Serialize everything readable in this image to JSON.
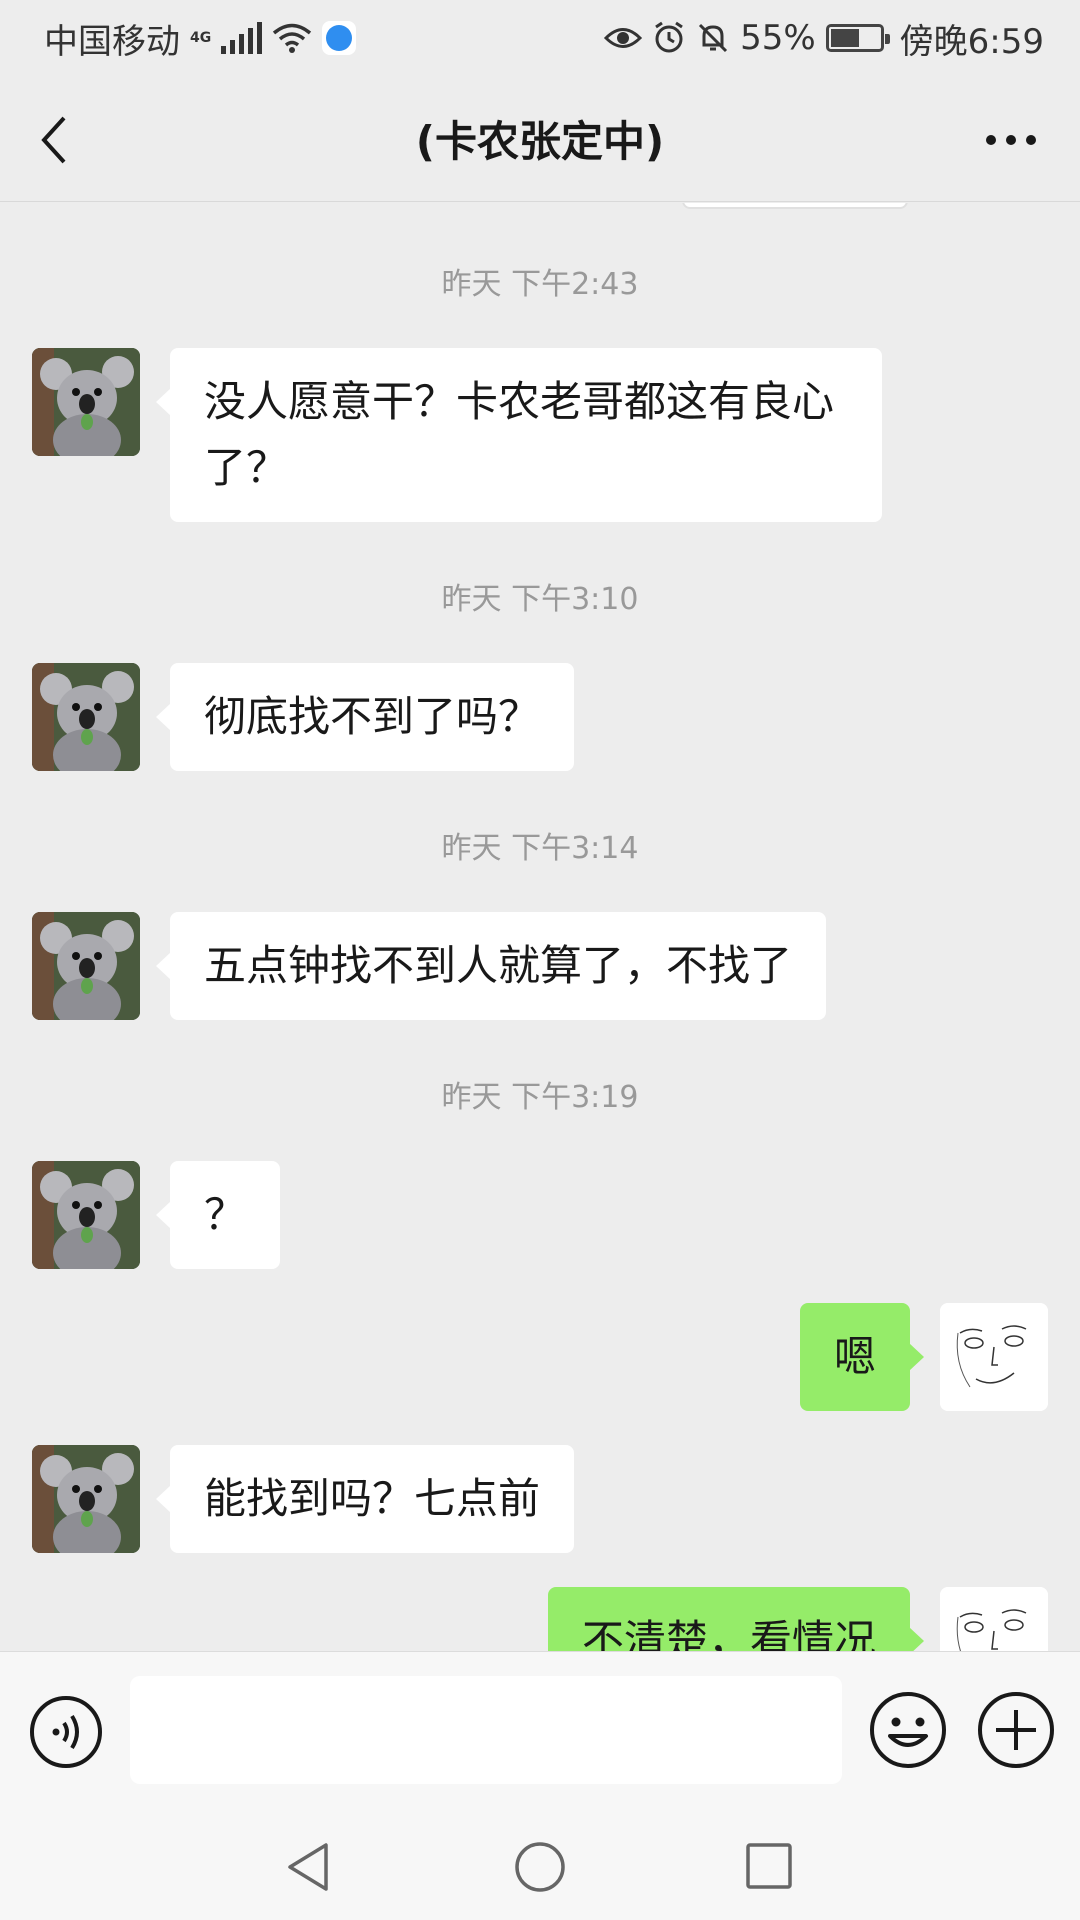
{
  "status_bar": {
    "carrier": "中国移动",
    "network": "4G",
    "battery": "55%",
    "time": "傍晚6:59"
  },
  "header": {
    "title": "(卡农张定中)"
  },
  "messages": [
    {
      "type": "time",
      "text": "昨天 下午2:43"
    },
    {
      "type": "msg",
      "side": "left",
      "text": "没人愿意干？卡农老哥都这有良心了？"
    },
    {
      "type": "time",
      "text": "昨天 下午3:10"
    },
    {
      "type": "msg",
      "side": "left",
      "text": "彻底找不到了吗？"
    },
    {
      "type": "time",
      "text": "昨天 下午3:14"
    },
    {
      "type": "msg",
      "side": "left",
      "text": "五点钟找不到人就算了，不找了"
    },
    {
      "type": "time",
      "text": "昨天 下午3:19"
    },
    {
      "type": "msg",
      "side": "left",
      "text": "？"
    },
    {
      "type": "msg",
      "side": "right",
      "text": "嗯"
    },
    {
      "type": "msg",
      "side": "left",
      "text": "能找到吗？七点前"
    },
    {
      "type": "msg",
      "side": "right",
      "text": "不清楚，看情况"
    }
  ],
  "input": {
    "value": ""
  },
  "colors": {
    "background": "#ededed",
    "bubble_self": "#95ec69",
    "bubble_other": "#ffffff"
  }
}
